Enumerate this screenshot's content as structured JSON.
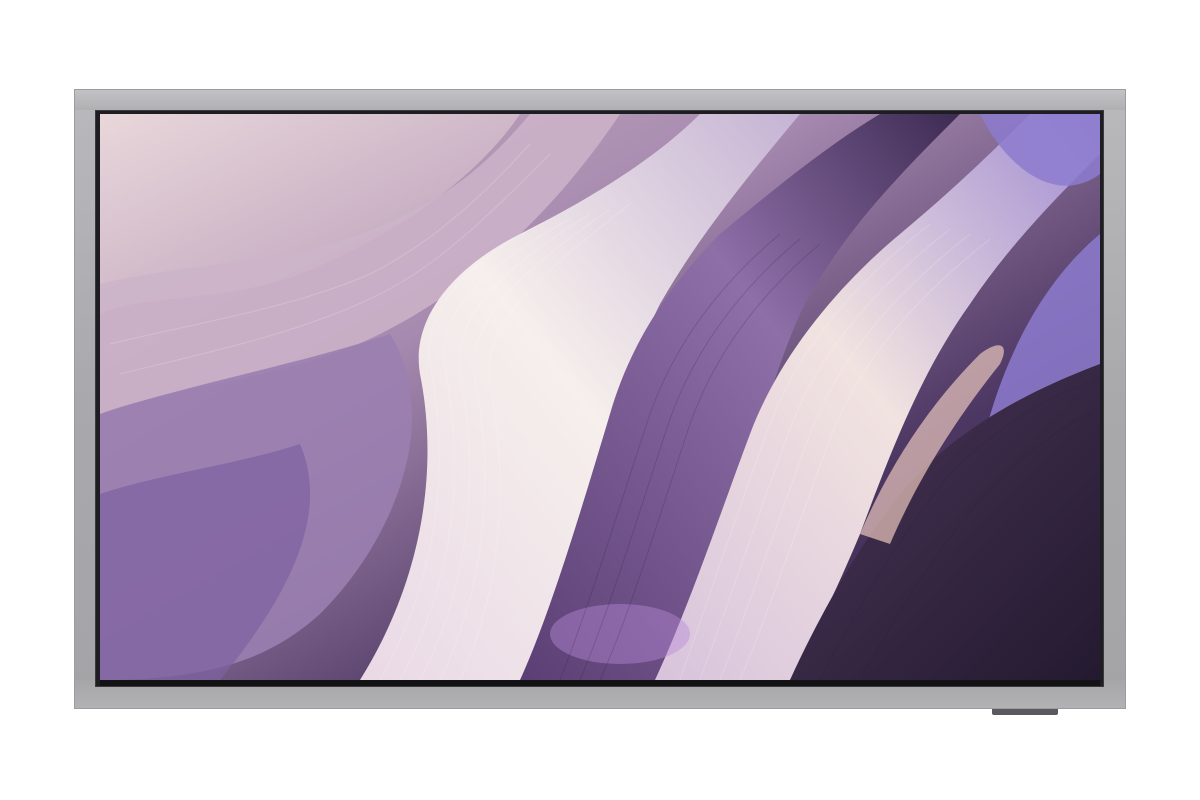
{
  "product": {
    "type": "wall display",
    "frame_color": "#acacae",
    "bezel_color": "#1e1e22",
    "screen_wallpaper": "abstract-silk-waves",
    "palette": [
      "#f4ece9",
      "#d9c3d6",
      "#b79ac4",
      "#6e4f86",
      "#3a2a4b",
      "#8a78c4"
    ]
  }
}
